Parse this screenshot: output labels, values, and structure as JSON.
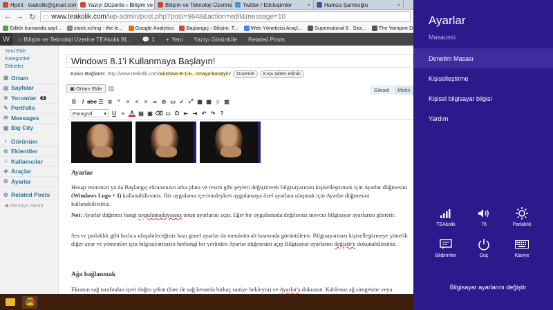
{
  "browser": {
    "tabs": [
      {
        "label": "Hpint - teakolik@gmail.com",
        "color": "#d14836",
        "active": false
      },
      {
        "label": "Yazıyı Düzenle ‹ Bilişim ve Te...",
        "color": "#d14836",
        "active": true
      },
      {
        "label": "Bilişim ve Teknoloji Üzerine",
        "color": "#d14836",
        "active": false
      },
      {
        "label": "Twitter / Etkileşimler",
        "color": "#3a9ad9",
        "active": false
      },
      {
        "label": "Hamza Şamlıoğlu",
        "color": "#3b5998",
        "active": false
      }
    ],
    "url_host": "www.teakolik.com",
    "url_path": "/wp-admin/post.php?post=9648&action=edit&message=10",
    "bookmarks": [
      {
        "label": "Editör kumanda sayf...",
        "color": "#4a4"
      },
      {
        "label": "stock.xchng - the le...",
        "color": "#888"
      },
      {
        "label": "Google Analytics",
        "color": "#e37400"
      },
      {
        "label": "Başlangıç ‹ Bilişim, T...",
        "color": "#d14836"
      },
      {
        "label": "Web Yöneticisi Araçl...",
        "color": "#4285f4"
      },
      {
        "label": "Supernatural 8 . Sez...",
        "color": "#555"
      },
      {
        "label": "The Vampire Diaries ...",
        "color": "#555"
      }
    ]
  },
  "adminbar": {
    "site": "Bilişim ve Teknoloji Üzerine TEAkolik Bl...",
    "comments": "1",
    "new": "Yeni",
    "view": "Yazıyı Görüntüle",
    "related": "Related Posts"
  },
  "sidebar": {
    "subitems": [
      "Yeni Ekle",
      "Kategoriler",
      "Etiketler"
    ],
    "group1": [
      {
        "label": "Ortam",
        "badge": ""
      },
      {
        "label": "Sayfalar",
        "badge": ""
      },
      {
        "label": "Yorumlar",
        "badge": "1"
      },
      {
        "label": "Portfolio",
        "badge": ""
      },
      {
        "label": "Messages",
        "badge": ""
      },
      {
        "label": "Big City",
        "badge": ""
      }
    ],
    "group2": [
      {
        "label": "Görünüm"
      },
      {
        "label": "Eklentiler"
      },
      {
        "label": "Kullanıcılar"
      },
      {
        "label": "Araçlar"
      },
      {
        "label": "Ayarlar"
      }
    ],
    "group3": [
      {
        "label": "Related Posts"
      }
    ],
    "collapse": "Menüyü daralt"
  },
  "editor": {
    "title": "Windows 8.1'i Kullanmaya Başlayın!",
    "permalink_label": "Kalıcı Bağlantı:",
    "permalink_base": "http://www.teakolik.com/",
    "permalink_slug": "windows-8-1i-k...nmaya-baslayin",
    "permalink_end": "/",
    "edit_btn": "Düzenle",
    "short_btn": "Kısa adres edinin",
    "add_media": "Ortam Ekle",
    "tab_visual": "Görsel",
    "tab_text": "Metin",
    "format": "Paragraf",
    "h_ayarlar": "Ayarlar",
    "p1a": "Hesap resminizi ya da Başlangıç ekranınızın arka planı ve resmi gibi şeyleri değiştirerek bilgisayarınızı kişiselleştirmek için Ayarlar düğmesini ",
    "p1b": "(Windows Logo + I)",
    "p1c": " kullanabilirsiniz. Bir uygulama içerisindeyken uygulamaya özel ayarlara ulaşmak için Ayarlar düğmesini kullanabilirsiniz.",
    "p2a": "Not:",
    "p2b": " Ayarlar düğmesi hangi ",
    "p2c": "uygulamadaysanız",
    "p2d": " onun ayarlarını açar. Eğer bir uygulamada değilseniz mevcut bilgisayar ayarlarını gösterir.",
    "p3a": "Ses ve parlaklık gibi hızlıca ulaşabileceğiniz bazı genel ayarlar da menünün alt kısmında görüntülenir.  Bilgisayarınızı kişiselleştirmeye yönelik diğer ayar ve yöntemler için bilgisayarınızın herhangi bir yerinden Ayarlar düğmesini açıp Bilgisayar ayarlarını ",
    "p3b": "değiştir'e",
    "p3c": " dokunabilirsiniz.",
    "h_network": "Ağa bağlanmak",
    "p4a": "Ekranın sağ tarafından içeri doğru çekin (fare ile sağ kenarda birkaç saniye bekleyin) ve ",
    "p4b": "Ayarlar'a",
    "p4c": " dokunun.  Kablosuz ağ simgesine veya kablolu ağ simgesine dokunun. Bağlanmak istediğiniz ağı seçin, bağlan tuşuna basın. Ağa bağlantınız gerçekleştirilecektir."
  },
  "charms": {
    "title": "Ayarlar",
    "subtitle": "Masaüstü",
    "items": [
      "Denetim Masası",
      "Kişiselleştirme",
      "Kişisel bilgisayar bilgisi",
      "Yardım"
    ],
    "quick": [
      {
        "label": "TEAkolik",
        "icon": "wifi-icon"
      },
      {
        "label": "76",
        "icon": "volume-icon"
      },
      {
        "label": "Parlaklık",
        "icon": "brightness-icon"
      },
      {
        "label": "Bildirimler",
        "icon": "notifications-icon"
      },
      {
        "label": "Güç",
        "icon": "power-icon"
      },
      {
        "label": "Klavye",
        "icon": "keyboard-icon"
      }
    ],
    "change_pc": "Bilgisayar ayarlarını değiştir",
    "bg": "#2a1a8c",
    "selected_bg": "#3d2d9e"
  }
}
